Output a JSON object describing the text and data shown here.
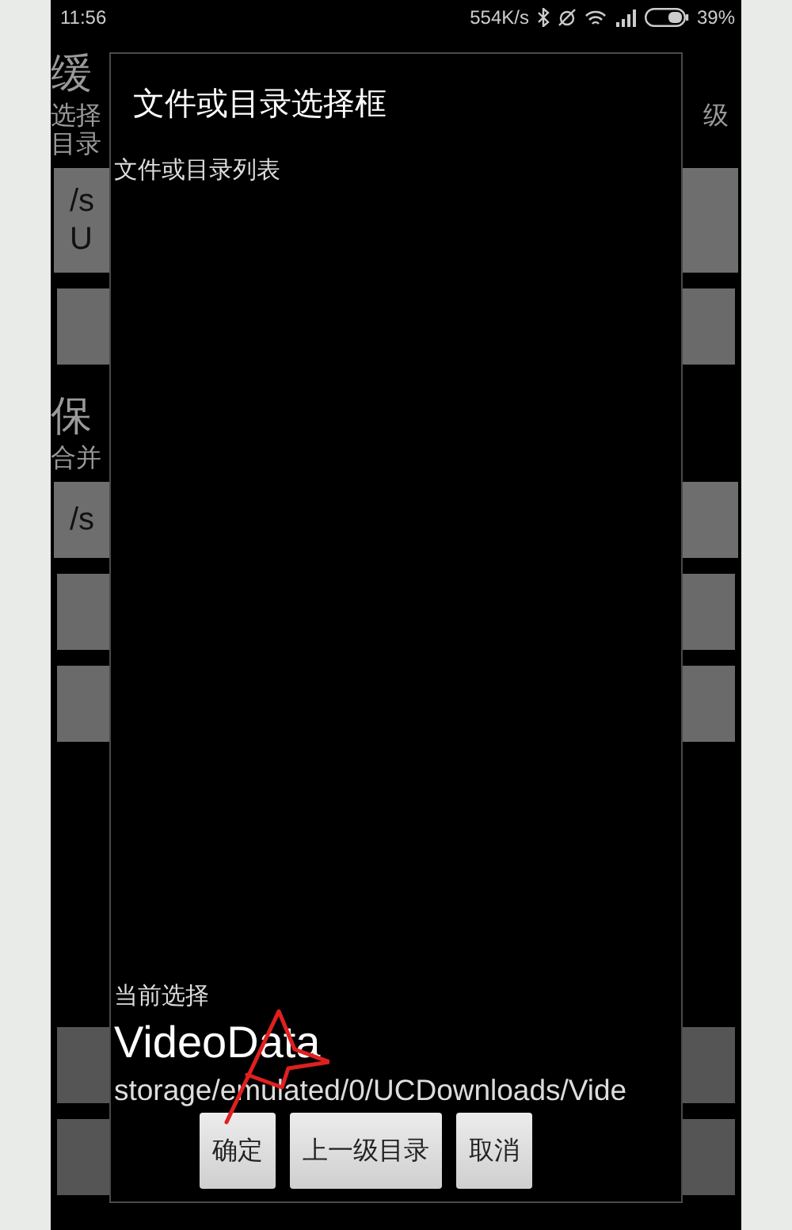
{
  "status_bar": {
    "time": "11:56",
    "speed": "554K/s",
    "battery": "39%"
  },
  "app": {
    "cache_section": {
      "title": "缓",
      "description_lines": [
        {
          "left": "选择",
          "right": "级"
        },
        {
          "left": "目录"
        }
      ],
      "path_lines": [
        "/s",
        "U"
      ]
    },
    "save_section": {
      "title": "保",
      "description": "合并",
      "path": "/s"
    }
  },
  "dialog": {
    "title": "文件或目录选择框",
    "list_label": "文件或目录列表",
    "current_label": "当前选择",
    "current_name": "VideoData",
    "current_path": "storage/emulated/0/UCDownloads/Vide",
    "buttons": [
      "确定",
      "上一级目录",
      "取消"
    ]
  }
}
